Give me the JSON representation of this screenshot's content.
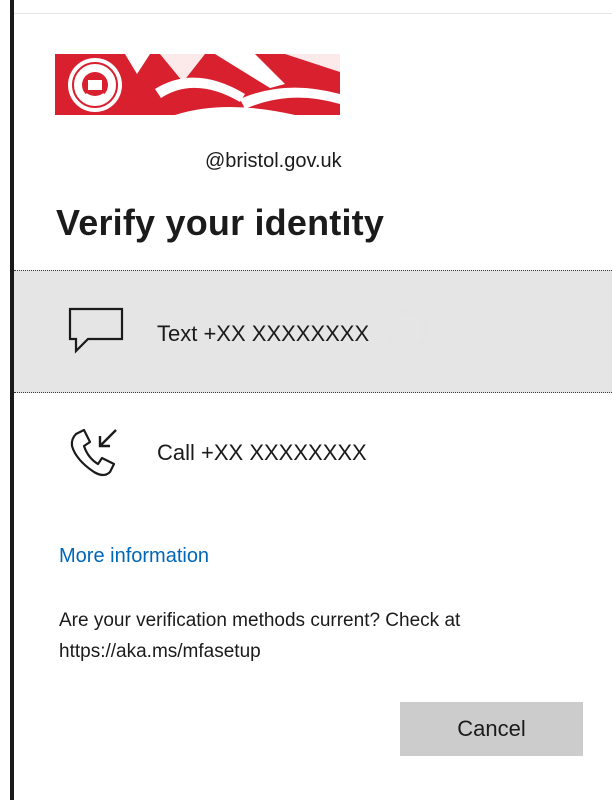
{
  "header": {
    "logo_icon": "bristol-city-council-logo",
    "brand_color": "#d9202f"
  },
  "account": {
    "email": "@bristol.gov.uk"
  },
  "page": {
    "title": "Verify your identity"
  },
  "methods": [
    {
      "label": "Text +XX XXXXXXXX",
      "icon": "sms-chat-icon",
      "selected": true
    },
    {
      "label": "Call +XX XXXXXXXX",
      "icon": "phone-call-icon",
      "selected": false
    }
  ],
  "links": {
    "more_information": "More information"
  },
  "notice": {
    "text": "Are your verification methods current? Check at https://aka.ms/mfasetup"
  },
  "actions": {
    "cancel_label": "Cancel"
  },
  "colors": {
    "link": "#0067b8",
    "selected_bg": "#e5e5e5",
    "button_bg": "#cccccc"
  }
}
